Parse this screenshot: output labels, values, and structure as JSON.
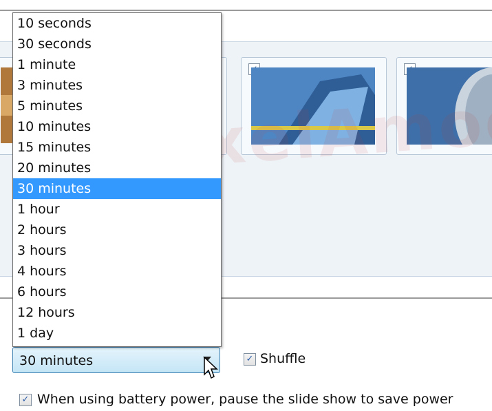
{
  "interval_options": [
    "10 seconds",
    "30 seconds",
    "1 minute",
    "3 minutes",
    "5 minutes",
    "10 minutes",
    "15 minutes",
    "20 minutes",
    "30 minutes",
    "1 hour",
    "2 hours",
    "3 hours",
    "4 hours",
    "6 hours",
    "12 hours",
    "1 day"
  ],
  "selected_index": 8,
  "combo": {
    "value": "30 minutes"
  },
  "shuffle": {
    "label": "Shuffle",
    "checked": true,
    "check_glyph": "✓"
  },
  "battery": {
    "label": "When using battery power, pause the slide show to save power",
    "checked": true,
    "check_glyph": "✓"
  },
  "thumbnails": [
    {
      "checked": true,
      "check_glyph": "✓",
      "image": "blue-architecture-photo-icon"
    },
    {
      "checked": true,
      "check_glyph": "✓",
      "image": "curved-building-photo-icon"
    }
  ],
  "watermark": {
    "text": "PixelAmooz.ir"
  },
  "colors": {
    "selection": "#3399ff",
    "combo_border": "#3c7fb1"
  }
}
